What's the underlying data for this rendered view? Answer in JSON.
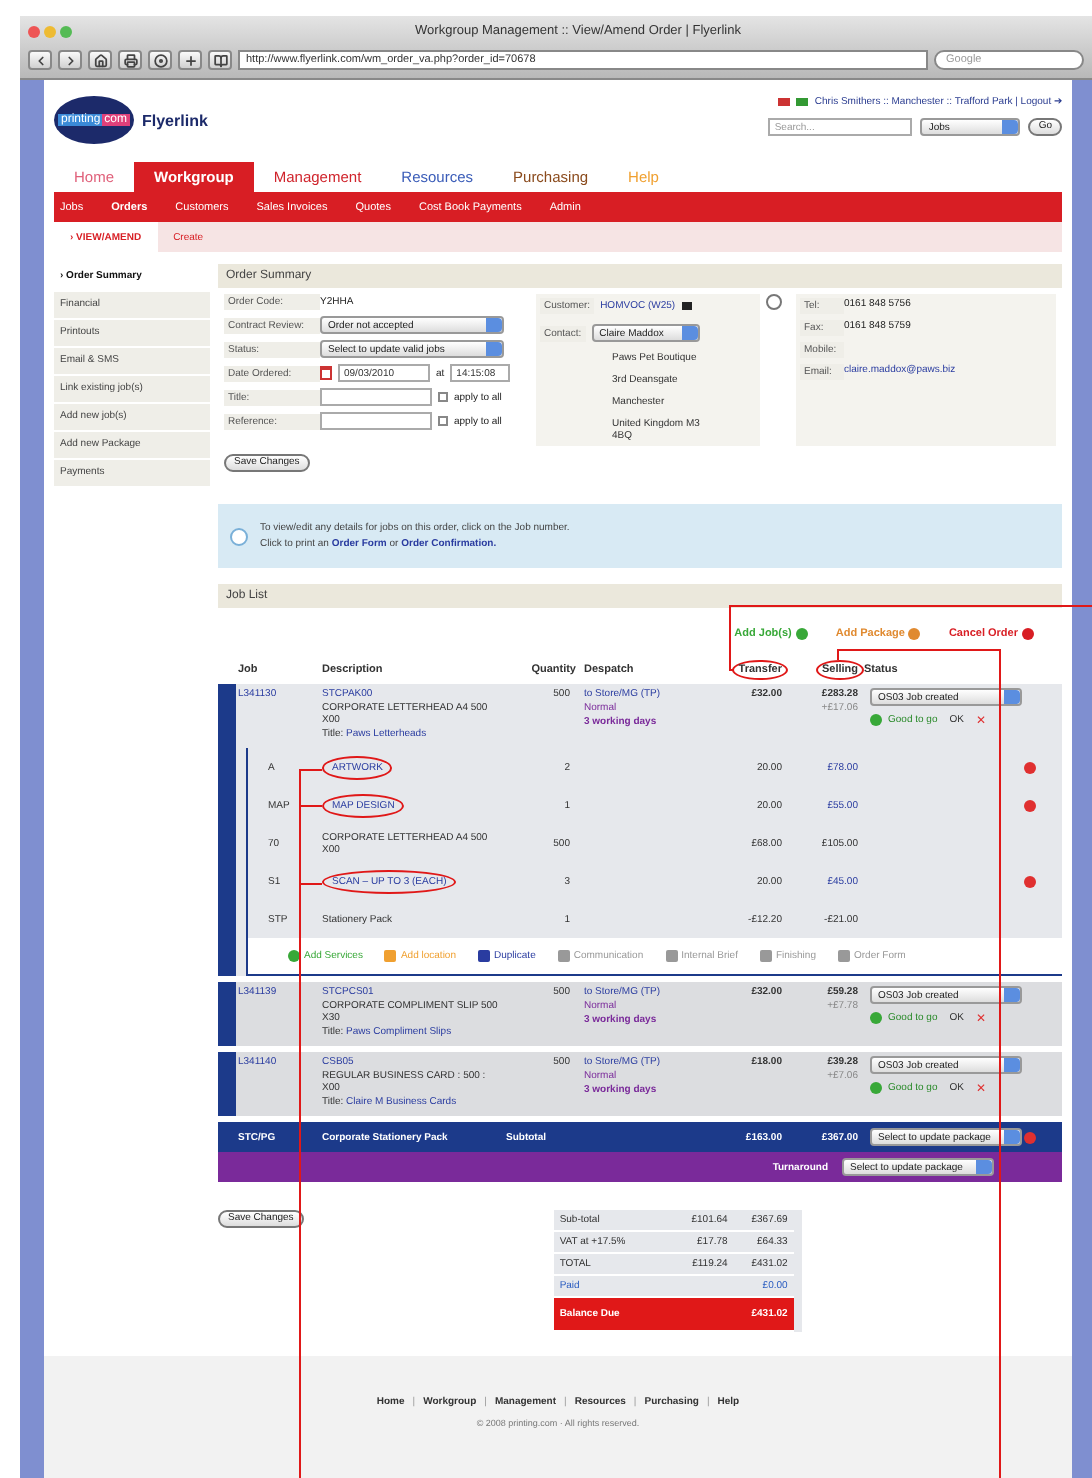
{
  "window": {
    "title": "Workgroup Management :: View/Amend Order | Flyerlink",
    "url": "http://www.flyerlink.com/wm_order_va.php?order_id=70678",
    "search_placeholder": "Google"
  },
  "header": {
    "logo_left": "printing",
    "logo_right": "com",
    "brand": "Flyerlink",
    "user": "Chris Smithers :: Manchester :: Trafford Park | Logout ➔",
    "search_placeholder": "Search...",
    "search_scope": "Jobs",
    "go": "Go"
  },
  "nav": [
    {
      "label": "Home",
      "selected": false,
      "color": "#e0607a"
    },
    {
      "label": "Workgroup",
      "selected": true,
      "color": "#d81e24"
    },
    {
      "label": "Management",
      "selected": false,
      "color": "#d0242c"
    },
    {
      "label": "Resources",
      "selected": false,
      "color": "#3a5cb8"
    },
    {
      "label": "Purchasing",
      "selected": false,
      "color": "#8a4a1c"
    },
    {
      "label": "Help",
      "selected": false,
      "color": "#f0a030"
    }
  ],
  "subnav": [
    {
      "label": "Jobs",
      "selected": false
    },
    {
      "label": "Orders",
      "selected": true
    },
    {
      "label": "Customers",
      "selected": false
    },
    {
      "label": "Sales Invoices",
      "selected": false
    },
    {
      "label": "Quotes",
      "selected": false
    },
    {
      "label": "Cost Book Payments",
      "selected": false
    },
    {
      "label": "Admin",
      "selected": false
    }
  ],
  "subsubnav": [
    {
      "label": "› VIEW/AMEND",
      "selected": true
    },
    {
      "label": "Create",
      "selected": false
    }
  ],
  "sidebar": [
    {
      "label": "› Order Summary",
      "selected": true
    },
    {
      "label": "Financial",
      "selected": false
    },
    {
      "label": "Printouts",
      "selected": false
    },
    {
      "label": "Email & SMS",
      "selected": false
    },
    {
      "label": "Link existing job(s)",
      "selected": false
    },
    {
      "label": "Add new job(s)",
      "selected": false
    },
    {
      "label": "Add new Package",
      "selected": false
    },
    {
      "label": "Payments",
      "selected": false
    }
  ],
  "order_summary": {
    "title": "Order Summary",
    "fields": [
      {
        "kind": "text",
        "label": "Order Code:",
        "value": "Y2HHA"
      },
      {
        "kind": "select",
        "label": "Contract Review:",
        "value": "Order not accepted"
      },
      {
        "kind": "select",
        "label": "Status:",
        "value": "Select to update valid jobs"
      },
      {
        "kind": "date",
        "label": "Date Ordered:",
        "value": "09/03/2010",
        "at": "at",
        "time": "14:15:08"
      },
      {
        "kind": "input",
        "label": "Title:",
        "check": "apply to all",
        "checked": false
      },
      {
        "kind": "input",
        "label": "Reference:",
        "check": "apply to all",
        "checked": false
      }
    ],
    "customer_label": "Customer:",
    "customer": "HOMVOC (W25)",
    "contact_label": "Contact:",
    "contact": "Claire Maddox",
    "address": [
      "Paws Pet Boutique",
      "3rd Deansgate",
      "Manchester",
      "United Kingdom M3 4BQ"
    ],
    "contacts": [
      {
        "kind": "phone",
        "label": "Tel:",
        "value": "0161 848 5756"
      },
      {
        "kind": "phone",
        "label": "Fax:",
        "value": "0161 848 5759"
      },
      {
        "kind": "phone",
        "label": "Mobile:"
      },
      {
        "kind": "email",
        "label": "Email:",
        "value": "claire.maddox@paws.biz"
      }
    ],
    "save": "Save Changes"
  },
  "info": {
    "line1": "To view/edit any details for jobs on this order, click on the Job number.",
    "line2_pre": "Click to print an",
    "form": "Order Form",
    "or": "or",
    "confirm": "Order Confirmation."
  },
  "job_list": {
    "title": "Job List",
    "actions": [
      {
        "kind": "add",
        "label": "Add Job(s)"
      },
      {
        "kind": "package",
        "label": "Add Package"
      },
      {
        "kind": "cancel",
        "label": "Cancel Order"
      }
    ],
    "columns": [
      {
        "label": "Job",
        "circled": false
      },
      {
        "label": "Description",
        "circled": false
      },
      {
        "label": "Quantity",
        "circled": false
      },
      {
        "label": "Despatch",
        "circled": false
      },
      {
        "label": "Transfer",
        "circled": true
      },
      {
        "label": "Selling",
        "circled": true
      },
      {
        "label": "Status",
        "circled": false
      }
    ],
    "jobs": [
      {
        "job": "L341130",
        "code": "STCPAK00",
        "desc": "CORPORATE LETTERHEAD A4 500 X00",
        "title_label": "Title:",
        "title": "Paws Letterheads",
        "quantity": "500",
        "despatch": "to Store/MG (TP)",
        "speed": "Normal",
        "days": "3 working days",
        "transfer": "£32.00",
        "selling": "£283.28",
        "selling_vat": "+£17.06",
        "status": "OS03 Job created",
        "ok": "Good to go",
        "ok2": "OK",
        "delete": "✕",
        "expanded": true,
        "items": [
          {
            "code": "A",
            "desc": "ARTWORK",
            "link": true,
            "circled": true,
            "quantity": "2",
            "transfer": "20.00",
            "selling": "£78.00",
            "removable": true
          },
          {
            "code": "MAP",
            "desc": "MAP DESIGN",
            "link": true,
            "circled": true,
            "quantity": "1",
            "transfer": "20.00",
            "selling": "£55.00",
            "removable": true
          },
          {
            "code": "70",
            "desc": "CORPORATE LETTERHEAD A4 500 X00",
            "link": false,
            "circled": false,
            "quantity": "500",
            "transfer": "£68.00",
            "selling": "£105.00",
            "removable": false
          },
          {
            "code": "S1",
            "desc": "SCAN – UP TO 3 (EACH)",
            "link": true,
            "circled": true,
            "quantity": "3",
            "transfer": "20.00",
            "selling": "£45.00",
            "removable": true
          },
          {
            "code": "STP",
            "desc": "Stationery Pack",
            "link": false,
            "circled": false,
            "quantity": "1",
            "transfer": "-£12.20",
            "selling": "-£21.00",
            "removable": false
          }
        ],
        "tools": [
          {
            "kind": "add",
            "label": "Add Services"
          },
          {
            "kind": "pin",
            "label": "Add location"
          },
          {
            "kind": "doc",
            "label": "Duplicate"
          },
          {
            "kind": "pen",
            "label": "Communication"
          },
          {
            "kind": "note",
            "label": "Internal Brief"
          },
          {
            "kind": "cut",
            "label": "Finishing"
          },
          {
            "kind": "page",
            "label": "Order Form"
          }
        ]
      },
      {
        "job": "L341139",
        "code": "STCPCS01",
        "desc": "CORPORATE COMPLIMENT SLIP 500 X30",
        "title_label": "Title:",
        "title": "Paws Compliment Slips",
        "quantity": "500",
        "despatch": "to Store/MG (TP)",
        "speed": "Normal",
        "days": "3 working days",
        "transfer": "£32.00",
        "selling": "£59.28",
        "selling_vat": "+£7.78",
        "status": "OS03 Job created",
        "ok": "Good to go",
        "ok2": "OK",
        "delete": "✕",
        "expanded": false
      },
      {
        "job": "L341140",
        "code": "CSB05",
        "desc": "REGULAR BUSINESS CARD : 500 : X00",
        "title_label": "Title:",
        "title": "Claire M Business Cards",
        "quantity": "500",
        "despatch": "to Store/MG (TP)",
        "speed": "Normal",
        "days": "3 working days",
        "transfer": "£18.00",
        "selling": "£39.28",
        "selling_vat": "+£7.06",
        "status": "OS03 Job created",
        "ok": "Good to go",
        "ok2": "OK",
        "delete": "✕",
        "expanded": false
      }
    ],
    "package": {
      "code": "STC/PG",
      "name": "Corporate Stationery Pack",
      "subtotal_label": "Subtotal",
      "transfer": "£163.00",
      "selling": "£367.00",
      "select": "Select to update package"
    },
    "turnaround": {
      "label": "Turnaround",
      "select": "Select to update package"
    }
  },
  "save2": "Save Changes",
  "totals": [
    {
      "label": "Sub-total",
      "transfer": "£101.64",
      "selling": "£367.69",
      "kind": "row"
    },
    {
      "label": "VAT at +17.5%",
      "transfer": "£17.78",
      "selling": "£64.33",
      "kind": "row"
    },
    {
      "label": "TOTAL",
      "transfer": "£119.24",
      "selling": "£431.02",
      "kind": "row"
    },
    {
      "label": "Paid",
      "selling": "£0.00",
      "kind": "paid"
    },
    {
      "label": "Balance Due",
      "selling": "£431.02",
      "kind": "due"
    }
  ],
  "footer": {
    "links": [
      "Home",
      "Workgroup",
      "Management",
      "Resources",
      "Purchasing",
      "Help"
    ],
    "separator": "|",
    "copyright": "© 2008 printing.com · All rights reserved."
  }
}
